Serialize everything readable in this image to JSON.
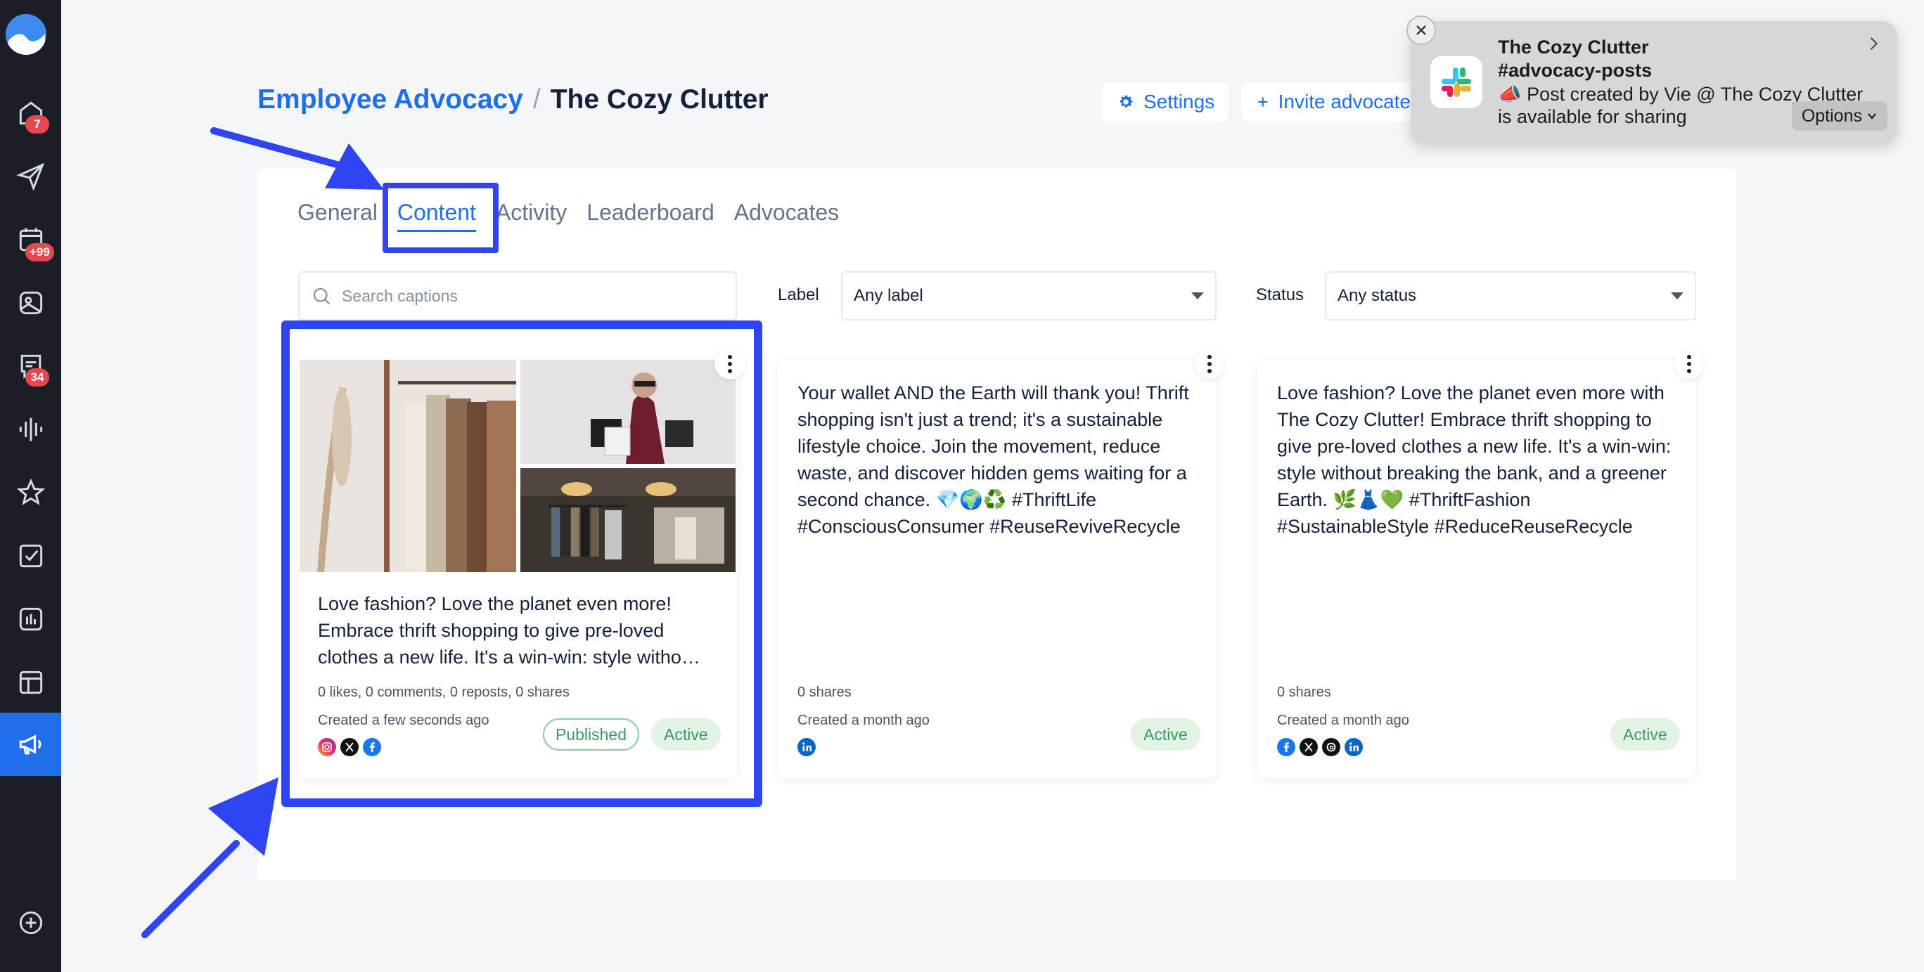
{
  "colors": {
    "brand": "#1f6feb",
    "sidebar_bg": "#1b1e27",
    "highlight": "#2f44f3",
    "active_green": "#3c9a5f",
    "badge_red": "#e5484d"
  },
  "sidebar": {
    "items": [
      {
        "icon": "home-icon",
        "badge": "7"
      },
      {
        "icon": "send-icon",
        "badge": ""
      },
      {
        "icon": "calendar-icon",
        "badge": "+99"
      },
      {
        "icon": "image-icon",
        "badge": ""
      },
      {
        "icon": "inbox-icon",
        "badge": "34"
      },
      {
        "icon": "audio-waves-icon",
        "badge": ""
      },
      {
        "icon": "star-icon",
        "badge": ""
      },
      {
        "icon": "task-check-icon",
        "badge": ""
      },
      {
        "icon": "analytics-icon",
        "badge": ""
      },
      {
        "icon": "layout-icon",
        "badge": ""
      },
      {
        "icon": "megaphone-icon",
        "badge": "",
        "active": true
      },
      {
        "icon": "add-circle-icon",
        "badge": ""
      }
    ]
  },
  "header": {
    "breadcrumb_root": "Employee Advocacy",
    "breadcrumb_separator": "/",
    "breadcrumb_current": "The Cozy Clutter",
    "settings_label": "Settings",
    "invite_label": "Invite advocate"
  },
  "tabs": [
    {
      "label": "General",
      "active": false
    },
    {
      "label": "Content",
      "active": true
    },
    {
      "label": "Activity",
      "active": false
    },
    {
      "label": "Leaderboard",
      "active": false
    },
    {
      "label": "Advocates",
      "active": false
    }
  ],
  "filters": {
    "search_placeholder": "Search captions",
    "label_title": "Label",
    "label_value": "Any label",
    "status_title": "Status",
    "status_value": "Any status"
  },
  "cards": [
    {
      "caption": "Love fashion? Love the planet even more! Embrace thrift shopping to give pre-loved clothes a new life. It's a win-win: style witho…",
      "meta": "0 likes, 0 comments, 0 reposts, 0 shares",
      "created": "Created a few seconds ago",
      "networks": [
        "instagram-icon",
        "x-icon",
        "facebook-icon"
      ],
      "published": "Published",
      "status": "Active"
    },
    {
      "caption": "Your wallet AND the Earth will thank you! Thrift shopping isn't just a trend; it's a sustainable lifestyle choice. Join the movement, reduce waste, and discover hidden gems waiting for a second chance. 💎🌍♻️ #ThriftLife #ConsciousConsumer #ReuseReviveRecycle",
      "meta": "0 shares",
      "created": "Created a month ago",
      "networks": [
        "linkedin-icon"
      ],
      "status": "Active"
    },
    {
      "caption": "Love fashion? Love the planet even more with The Cozy Clutter! Embrace thrift shopping to give pre-loved clothes a new life. It's a win-win: style without breaking the bank, and a greener Earth. 🌿👗💚 #ThriftFashion #SustainableStyle #ReduceReuseRecycle",
      "meta": "0 shares",
      "created": "Created a month ago",
      "networks": [
        "facebook-icon",
        "x-icon",
        "threads-icon",
        "linkedin-icon"
      ],
      "status": "Active"
    }
  ],
  "notification": {
    "title": "The Cozy Clutter",
    "channel": "#advocacy-posts",
    "body_line1": "📣 Post created by Vie @ The Cozy Clutter",
    "body_line2": "is available for sharing",
    "options_label": "Options"
  }
}
